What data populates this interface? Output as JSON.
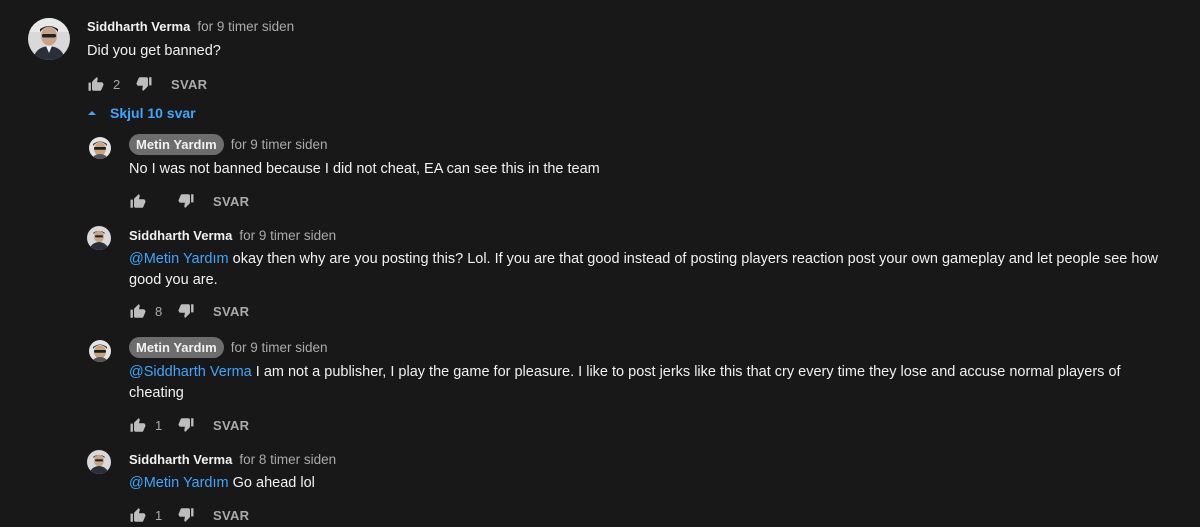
{
  "top_comment": {
    "author": "Siddharth Verma",
    "time": "for 9 timer siden",
    "text": "Did you get banned?",
    "likes": "2",
    "reply_label": "SVAR"
  },
  "replies_toggle": {
    "label": "Skjul 10 svar",
    "icon": "caret-up-icon",
    "color": "#3ea6ff"
  },
  "replies": [
    {
      "author": "Metin Yardım",
      "author_is_owner": true,
      "time": "for 9 timer siden",
      "mention": "",
      "text": "No I was not banned because I did not cheat, EA can see this in the team",
      "likes": "",
      "reply_label": "SVAR"
    },
    {
      "author": "Siddharth Verma",
      "author_is_owner": false,
      "time": "for 9 timer siden",
      "mention": "@Metin Yardım",
      "text": " okay then why are you posting this? Lol. If you are that good instead of posting players reaction post your own gameplay and let people see how good you are.",
      "likes": "8",
      "reply_label": "SVAR"
    },
    {
      "author": "Metin Yardım",
      "author_is_owner": true,
      "time": "for 9 timer siden",
      "mention": "@Siddharth Verma",
      "text": " I am not a publisher, I play the game for pleasure. I like to post jerks like this that cry every time they lose and accuse normal players of cheating",
      "likes": "1",
      "reply_label": "SVAR"
    },
    {
      "author": "Siddharth Verma",
      "author_is_owner": false,
      "time": "for 8 timer siden",
      "mention": "@Metin Yardım",
      "text": " Go ahead lol",
      "likes": "1",
      "reply_label": "SVAR"
    }
  ],
  "colors": {
    "background": "#181818",
    "text": "#f1f1f1",
    "secondary": "#aaaaaa",
    "mention": "#3ea6ff",
    "owner_chip": "#6d6d6d"
  }
}
